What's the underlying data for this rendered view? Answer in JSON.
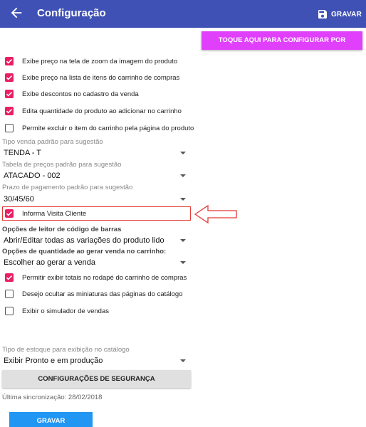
{
  "appbar": {
    "title": "Configuração",
    "save_label": "GRAVAR",
    "back_icon": "arrow-left-icon",
    "save_icon": "floppy-disk-icon",
    "color": "#3f51b5"
  },
  "catalog_button": {
    "label": "TOQUE AQUI PARA CONFIGURAR POR CATÁLOGO",
    "color": "#e040fb"
  },
  "checkbox_checked_color": "#e91e63",
  "options_top": [
    {
      "label": "Exibe preço na tela de zoom da imagem do produto",
      "checked": true
    },
    {
      "label": "Exibe preço na lista de itens do carrinho de compras",
      "checked": true
    },
    {
      "label": "Exibe descontos no cadastro da venda",
      "checked": true
    },
    {
      "label": "Edita quantidade do produto ao adicionar no carrinho",
      "checked": true
    },
    {
      "label": "Permite excluir o item do carrinho pela página do produto",
      "checked": false
    }
  ],
  "selects": [
    {
      "label": "Tipo venda padrão para sugestão",
      "value": "TENDA - T"
    },
    {
      "label": "Tabela de preços padrão para sugestão",
      "value": "ATACADO - 002"
    },
    {
      "label": "Prazo de pagamento padrão para sugestão",
      "value": "30/45/60"
    }
  ],
  "visit_option": {
    "label": "Informa Visita Cliente",
    "checked": true
  },
  "barcode": {
    "label": "Opções de leitor de código de barras",
    "value": "Abrir/Editar todas as variações do produto lido"
  },
  "quantity": {
    "label": "Opções de quantidade ao gerar venda no carrinho:",
    "value": "Escolher ao gerar a venda"
  },
  "options_bottom": [
    {
      "label": "Permitir exibir totais no rodapé do carrinho de compras",
      "checked": true
    },
    {
      "label": "Desejo ocultar as miniaturas das páginas do catálogo",
      "checked": false
    },
    {
      "label": "Exibir o simulador de vendas",
      "checked": false
    }
  ],
  "stock": {
    "label": "Tipo de estoque para exibição no catálogo",
    "value": "Exibir Pronto e em produção"
  },
  "security_button": {
    "label": "CONFIGURAÇÕES DE SEGURANÇA"
  },
  "sync_text": "Última sincronização: 28/02/2018",
  "save_button": {
    "label": "GRAVAR",
    "color": "#2196f3"
  },
  "annotation": {
    "color": "#e53935"
  }
}
